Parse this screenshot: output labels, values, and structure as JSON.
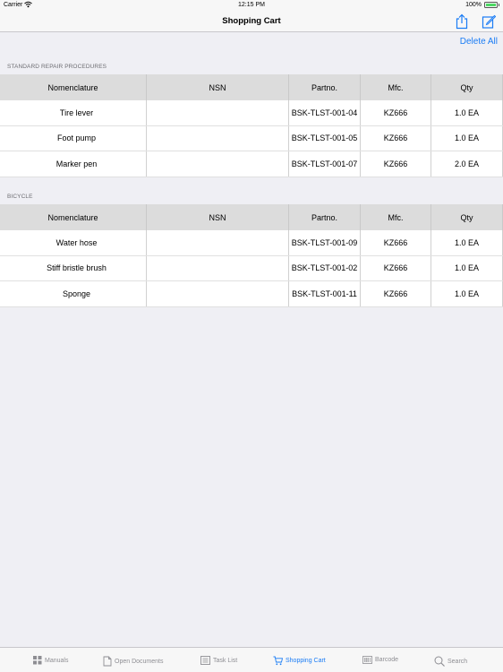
{
  "status_bar": {
    "carrier": "Carrier",
    "time": "12:15 PM",
    "battery": "100%"
  },
  "nav": {
    "title": "Shopping Cart"
  },
  "actions": {
    "delete_all": "Delete All"
  },
  "columns": [
    "Nomenclature",
    "NSN",
    "Partno.",
    "Mfc.",
    "Qty"
  ],
  "sections": [
    {
      "title": "STANDARD REPAIR PROCEDURES",
      "rows": [
        {
          "nomenclature": "Tire lever",
          "nsn": "",
          "partno": "BSK-TLST-001-04",
          "mfc": "KZ666",
          "qty": "1.0 EA"
        },
        {
          "nomenclature": "Foot pump",
          "nsn": "",
          "partno": "BSK-TLST-001-05",
          "mfc": "KZ666",
          "qty": "1.0 EA"
        },
        {
          "nomenclature": "Marker pen",
          "nsn": "",
          "partno": "BSK-TLST-001-07",
          "mfc": "KZ666",
          "qty": "2.0 EA"
        }
      ]
    },
    {
      "title": "BICYCLE",
      "rows": [
        {
          "nomenclature": "Water hose",
          "nsn": "",
          "partno": "BSK-TLST-001-09",
          "mfc": "KZ666",
          "qty": "1.0 EA"
        },
        {
          "nomenclature": "Stiff bristle brush",
          "nsn": "",
          "partno": "BSK-TLST-001-02",
          "mfc": "KZ666",
          "qty": "1.0 EA"
        },
        {
          "nomenclature": "Sponge",
          "nsn": "",
          "partno": "BSK-TLST-001-11",
          "mfc": "KZ666",
          "qty": "1.0 EA"
        }
      ]
    }
  ],
  "tabs": [
    {
      "label": "Manuals",
      "icon": "grid-icon"
    },
    {
      "label": "Open Documents",
      "icon": "document-icon"
    },
    {
      "label": "Task List",
      "icon": "list-icon"
    },
    {
      "label": "Shopping Cart",
      "icon": "cart-icon",
      "active": true
    },
    {
      "label": "Barcode",
      "icon": "barcode-icon"
    },
    {
      "label": "Search",
      "icon": "search-icon"
    }
  ],
  "colors": {
    "accent": "#1a7cf5",
    "inactive": "#8e8e93",
    "header_row": "#dcdcdc",
    "background": "#efeff4"
  }
}
